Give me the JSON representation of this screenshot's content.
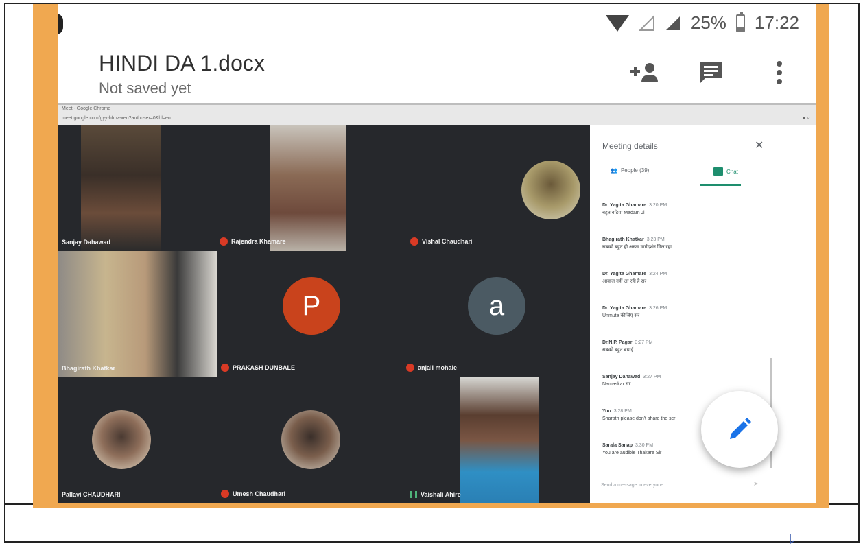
{
  "status_bar": {
    "battery": "25%",
    "time": "17:22"
  },
  "doc": {
    "title": "HINDI DA 1.docx",
    "subtitle": "Not saved yet"
  },
  "header_icons": [
    "add-person-icon",
    "comment-icon",
    "more-vert-icon"
  ],
  "meet": {
    "chrome_title": "Meet - Google Chrome",
    "chrome_url": "meet.google.com/gyy-hfmz-xen?authuser=0&hl=en",
    "participants": [
      {
        "name": "Sanjay Dahawad",
        "mic": "on"
      },
      {
        "name": "Rajendra Khamare",
        "mic": "off"
      },
      {
        "name": "Vishal Chaudhari",
        "mic": "off"
      },
      {
        "name": "Bhagirath Khatkar",
        "mic": "on"
      },
      {
        "name": "PRAKASH DUNBALE",
        "mic": "off",
        "avatar_letter": "P",
        "avatar_color": "#c9431c"
      },
      {
        "name": "anjali mohale",
        "mic": "off",
        "avatar_letter": "a",
        "avatar_color": "#4b5a63"
      },
      {
        "name": "Pallavi CHAUDHARI",
        "mic": "on"
      },
      {
        "name": "Umesh Chaudhari",
        "mic": "off"
      },
      {
        "name": "Vaishali Ahire",
        "mic": "on"
      }
    ],
    "panel": {
      "title": "Meeting details",
      "close": "✕",
      "tab_people": "People (39)",
      "tab_chat": "Chat",
      "messages": [
        {
          "sender": "Dr. Yagita Ghamare",
          "time": "3:20 PM",
          "text": "बहुत बढ़िया Madam Ji"
        },
        {
          "sender": "Bhagirath Khatkar",
          "time": "3:23 PM",
          "text": "सबको बहुत ही अच्छा मार्गदर्शन मिल रहा"
        },
        {
          "sender": "Dr. Yagita Ghamare",
          "time": "3:24 PM",
          "text": "आवाज नहीं आ रही है सर"
        },
        {
          "sender": "Dr. Yagita Ghamare",
          "time": "3:26 PM",
          "text": "Unmute कीजिए सर"
        },
        {
          "sender": "Dr.N.P. Pagar",
          "time": "3:27 PM",
          "text": "सबको बहुत बधाई"
        },
        {
          "sender": "Sanjay Dahawad",
          "time": "3:27 PM",
          "text": "Namaskar सर"
        },
        {
          "sender": "You",
          "time": "3:28 PM",
          "text": "Sharath please don't share the scr"
        },
        {
          "sender": "Sarala Sanap",
          "time": "3:30 PM",
          "text": "You are audible Thakare Sir"
        }
      ],
      "input_placeholder": "Send a message to everyone"
    }
  },
  "fab_icon": "edit-pencil-icon"
}
